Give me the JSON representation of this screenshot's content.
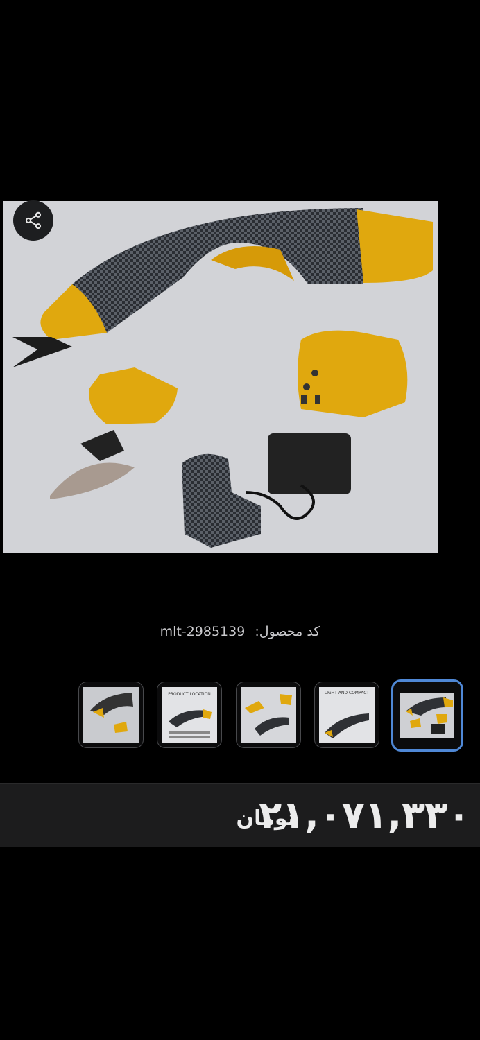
{
  "gallery": {
    "main_image": "product-photo",
    "share_icon": "share-icon",
    "thumbnails": [
      {
        "caption": ""
      },
      {
        "caption": "PRODUCT LOCATION"
      },
      {
        "caption": ""
      },
      {
        "caption": "LIGHT AND COMPACT"
      },
      {
        "caption": "",
        "selected": true
      }
    ]
  },
  "product": {
    "code_label": "کد محصول:",
    "code_value": "mlt-2985139"
  },
  "price": {
    "amount": "۲۱,۰۷۱,۳۳۰",
    "currency": "تومان"
  },
  "colors": {
    "background": "#000000",
    "price_bar": "#1c1c1d",
    "selected_border": "#4f88d6",
    "product_accent": "#e0a80e"
  }
}
